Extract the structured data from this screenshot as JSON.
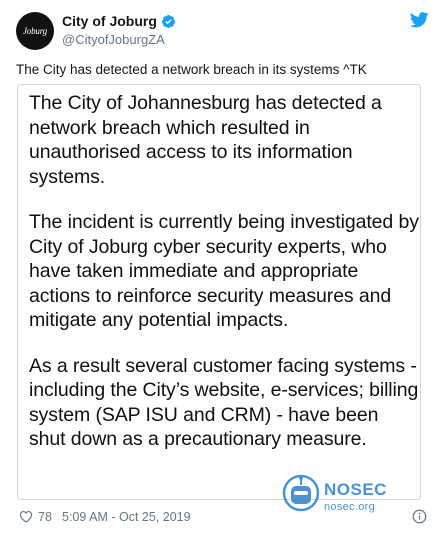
{
  "account": {
    "display_name": "City of Joburg",
    "handle": "@CityofJoburgZA",
    "avatar_text": "Joburg",
    "verified": true
  },
  "tweet": {
    "text": "The City has detected a network breach in its systems ^TK",
    "image_paragraphs": [
      "The City of Johannesburg has detected a network breach which resulted in unauthorised access to its information systems.",
      "The incident is currently being investigated by City of Joburg cyber security experts, who have taken immediate and appropriate actions to reinforce security measures and mitigate any potential impacts.",
      "As a result several customer facing systems - including the City’s website, e-services; billing system (SAP ISU and CRM) - have been shut down as a precautionary measure."
    ]
  },
  "footer": {
    "like_count": "78",
    "timestamp": "5:09 AM - Oct 25, 2019"
  },
  "watermark": {
    "brand": "NOSEC",
    "site": "nosec.org"
  },
  "colors": {
    "twitter_blue": "#1da1f2",
    "secondary_text": "#657786",
    "watermark_blue": "#2f7fc8"
  },
  "icons": {
    "verified": "verified-badge-icon",
    "twitter": "twitter-bird-icon",
    "like": "heart-icon",
    "info": "info-icon"
  }
}
